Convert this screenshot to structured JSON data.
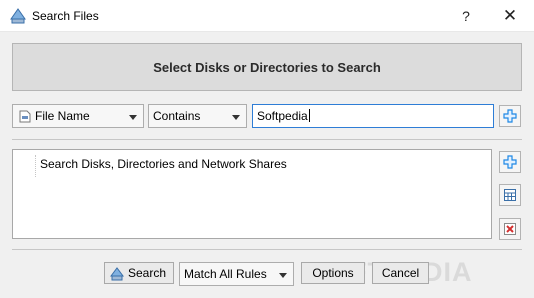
{
  "window": {
    "title": "Search Files",
    "help_label": "?",
    "close_label": "✕"
  },
  "banner": {
    "text": "Select Disks or Directories to Search"
  },
  "criteria": {
    "field_combo": "File Name",
    "operator_combo": "Contains",
    "value_input": "Softpedia"
  },
  "locations": {
    "items": [
      "Search Disks, Directories and Network Shares"
    ]
  },
  "footer": {
    "search_label": "Search",
    "match_combo": "Match All Rules",
    "options_label": "Options",
    "cancel_label": "Cancel"
  },
  "watermark": "SOFTPEDIA",
  "colors": {
    "accent": "#2e7dd6",
    "add_icon": "#1e88e5",
    "remove_icon": "#d32f2f"
  },
  "icons": [
    "search-files-app-icon",
    "file-name-icon",
    "add-rule-icon",
    "add-location-icon",
    "edit-location-icon",
    "remove-location-icon",
    "search-icon",
    "help-icon",
    "close-icon"
  ]
}
